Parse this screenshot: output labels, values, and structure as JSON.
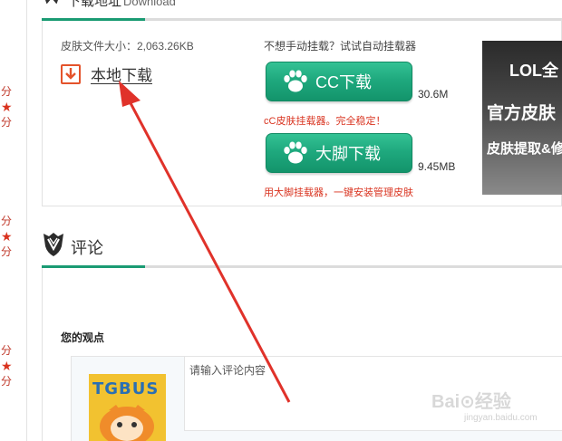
{
  "left_ratings": [
    {
      "top": "分",
      "bottom": "分"
    },
    {
      "top": "分",
      "bottom": "分"
    },
    {
      "top": "分",
      "bottom": "分"
    }
  ],
  "download": {
    "title": "下载地址",
    "title_en": "Download",
    "file_size_label": "皮肤文件大小：2,063.26KB",
    "local_download": "本地下载",
    "auto_tip": "不想手动挂载？试试自动挂载器",
    "cc_button": "CC下载",
    "cc_size": "30.6M",
    "cc_note": "cC皮肤挂载器。完全稳定！",
    "dajiao_button": "大脚下载",
    "dajiao_size": "9.45MB",
    "dajiao_note": "用大脚挂载器，一键安装管理皮肤"
  },
  "banner": {
    "line1": "LOL全",
    "line2": "官方皮肤",
    "line3": "皮肤提取&修"
  },
  "comment": {
    "title": "评论",
    "opinion_label": "您的观点",
    "placeholder": "请输入评论内容",
    "avatar_brand": "TGBUS"
  },
  "watermark": {
    "main": "Bai⊙经验",
    "sub": "jingyan.baidu.com"
  },
  "colors": {
    "accent_green": "#1a9b73",
    "button_green": "#1fa97e",
    "note_red": "#d9331f",
    "arrow_red": "#e0322a"
  }
}
